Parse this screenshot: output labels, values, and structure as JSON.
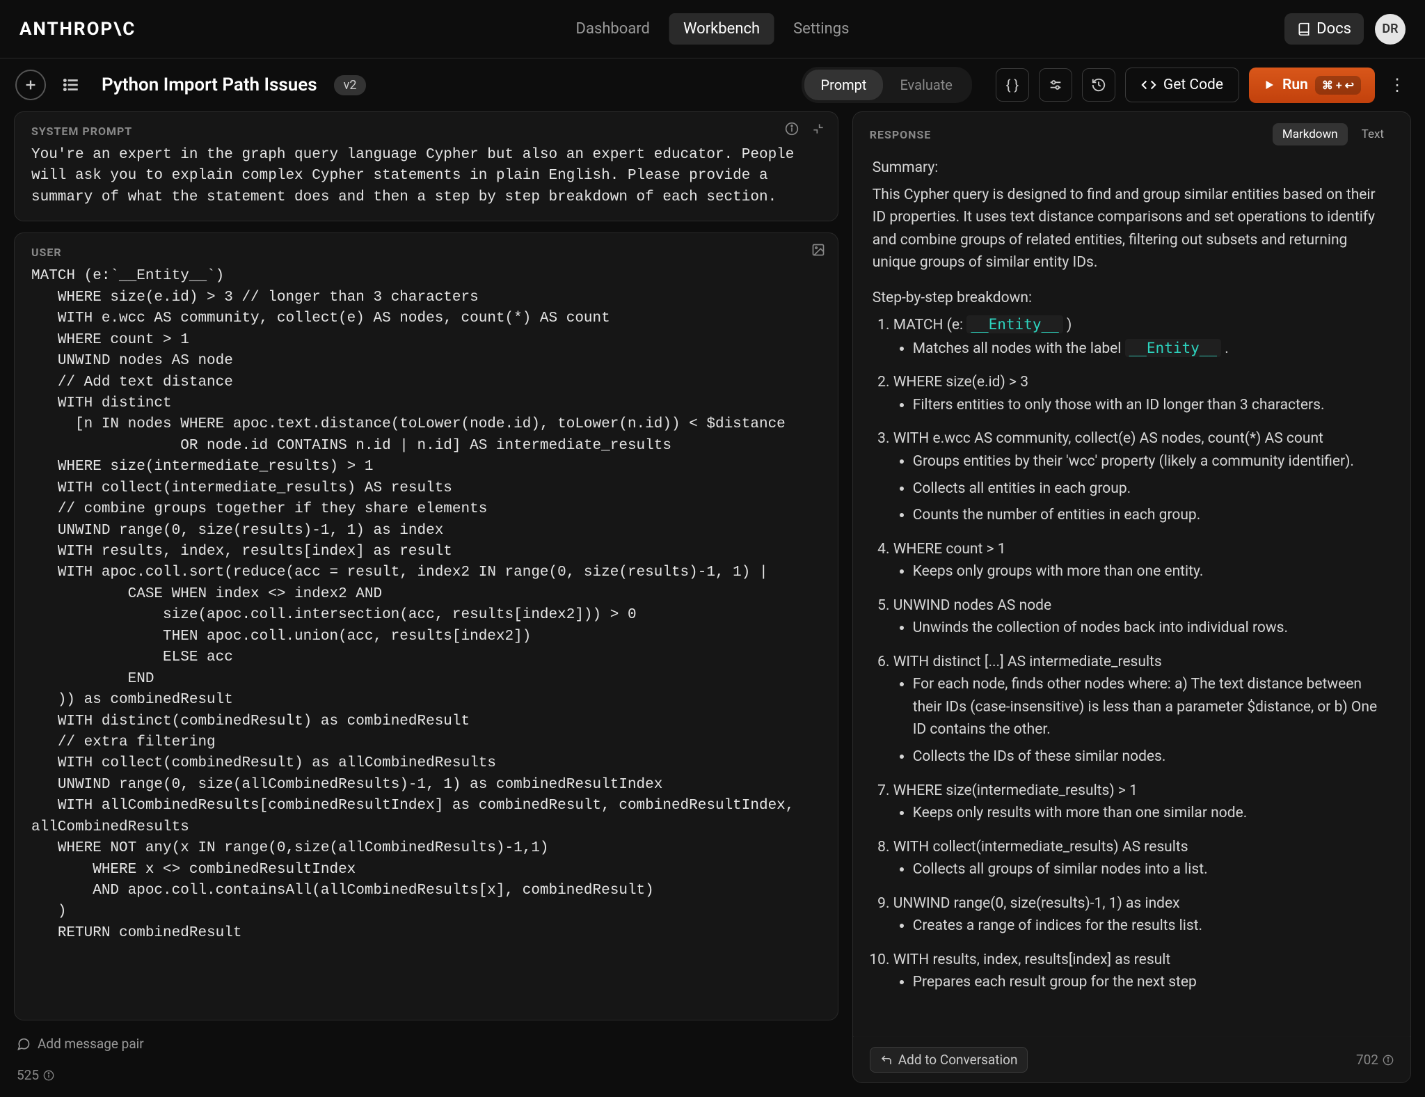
{
  "brand": "ANTHROP\\C",
  "nav": {
    "dashboard": "Dashboard",
    "workbench": "Workbench",
    "settings": "Settings"
  },
  "topbar": {
    "docs": "Docs",
    "avatar_initials": "DR"
  },
  "toolbar": {
    "title": "Python Import Path Issues",
    "version": "v2",
    "prompt_tab": "Prompt",
    "evaluate_tab": "Evaluate",
    "get_code": "Get Code",
    "run": "Run",
    "shortcut": "⌘ + ↩"
  },
  "system": {
    "label": "SYSTEM PROMPT",
    "text": "You're an expert in the graph query language Cypher but also an expert educator. People will ask you to explain complex Cypher statements in plain English. Please provide a summary of what the statement does and then a step by step breakdown of each section."
  },
  "user": {
    "label": "USER",
    "text": "MATCH (e:`__Entity__`)\n   WHERE size(e.id) > 3 // longer than 3 characters\n   WITH e.wcc AS community, collect(e) AS nodes, count(*) AS count\n   WHERE count > 1\n   UNWIND nodes AS node\n   // Add text distance\n   WITH distinct\n     [n IN nodes WHERE apoc.text.distance(toLower(node.id), toLower(n.id)) < $distance\n                 OR node.id CONTAINS n.id | n.id] AS intermediate_results\n   WHERE size(intermediate_results) > 1\n   WITH collect(intermediate_results) AS results\n   // combine groups together if they share elements\n   UNWIND range(0, size(results)-1, 1) as index\n   WITH results, index, results[index] as result\n   WITH apoc.coll.sort(reduce(acc = result, index2 IN range(0, size(results)-1, 1) |\n           CASE WHEN index <> index2 AND\n               size(apoc.coll.intersection(acc, results[index2])) > 0\n               THEN apoc.coll.union(acc, results[index2])\n               ELSE acc\n           END\n   )) as combinedResult\n   WITH distinct(combinedResult) as combinedResult\n   // extra filtering\n   WITH collect(combinedResult) as allCombinedResults\n   UNWIND range(0, size(allCombinedResults)-1, 1) as combinedResultIndex\n   WITH allCombinedResults[combinedResultIndex] as combinedResult, combinedResultIndex, allCombinedResults\n   WHERE NOT any(x IN range(0,size(allCombinedResults)-1,1)\n       WHERE x <> combinedResultIndex\n       AND apoc.coll.containsAll(allCombinedResults[x], combinedResult)\n   )\n   RETURN combinedResult"
  },
  "left_footer": {
    "add_pair": "Add message pair",
    "token_count": "525"
  },
  "response": {
    "label": "RESPONSE",
    "view_md": "Markdown",
    "view_text": "Text",
    "summary_label": "Summary:",
    "summary_text": "This Cypher query is designed to find and group similar entities based on their ID properties. It uses text distance comparisons and set operations to identify and combine groups of related entities, filtering out subsets and returning unique groups of similar entity IDs.",
    "breakdown_label": "Step-by-step breakdown:",
    "steps": [
      {
        "head_pre": "MATCH (e: ",
        "head_code": "__Entity__",
        "head_post": " )",
        "bullets": [
          {
            "pre": "Matches all nodes with the label ",
            "code": "__Entity__",
            "post": " ."
          }
        ]
      },
      {
        "head_pre": "WHERE size(e.id) > 3",
        "bullets": [
          {
            "pre": "Filters entities to only those with an ID longer than 3 characters."
          }
        ]
      },
      {
        "head_pre": "WITH e.wcc AS community, collect(e) AS nodes, count(*) AS count",
        "bullets": [
          {
            "pre": "Groups entities by their 'wcc' property (likely a community identifier)."
          },
          {
            "pre": "Collects all entities in each group."
          },
          {
            "pre": "Counts the number of entities in each group."
          }
        ]
      },
      {
        "head_pre": "WHERE count > 1",
        "bullets": [
          {
            "pre": "Keeps only groups with more than one entity."
          }
        ]
      },
      {
        "head_pre": "UNWIND nodes AS node",
        "bullets": [
          {
            "pre": "Unwinds the collection of nodes back into individual rows."
          }
        ]
      },
      {
        "head_pre": "WITH distinct [...] AS intermediate_results",
        "bullets": [
          {
            "pre": "For each node, finds other nodes where: a) The text distance between their IDs (case-insensitive) is less than a parameter $distance, or b) One ID contains the other."
          },
          {
            "pre": "Collects the IDs of these similar nodes."
          }
        ]
      },
      {
        "head_pre": "WHERE size(intermediate_results) > 1",
        "bullets": [
          {
            "pre": "Keeps only results with more than one similar node."
          }
        ]
      },
      {
        "head_pre": "WITH collect(intermediate_results) AS results",
        "bullets": [
          {
            "pre": "Collects all groups of similar nodes into a list."
          }
        ]
      },
      {
        "head_pre": "UNWIND range(0, size(results)-1, 1) as index",
        "bullets": [
          {
            "pre": "Creates a range of indices for the results list."
          }
        ]
      },
      {
        "head_pre": "WITH results, index, results[index] as result",
        "bullets": [
          {
            "pre": "Prepares each result group for the next step"
          }
        ]
      }
    ],
    "add_conv": "Add to Conversation",
    "token_count": "702"
  }
}
